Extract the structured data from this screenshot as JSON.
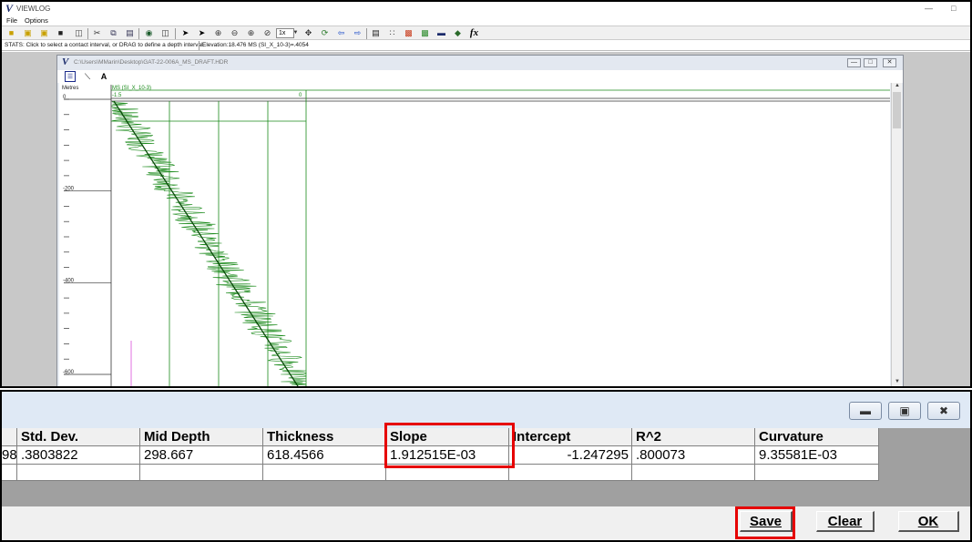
{
  "app": {
    "title": "VIEWLOG",
    "menus": [
      "File",
      "Options"
    ],
    "zoom": "1x",
    "status": "STATS: Click to select a contact interval, or DRAG to define a depth interval.",
    "elevation": "Elevation:18.476 MS (SI_X_10-3)=.4054"
  },
  "document": {
    "path": "C:\\Users\\MMarin\\Desktop\\GAT-22-006A_MS_DRAFT.HDR",
    "depth_unit": "Metres",
    "depth_ticks": [
      "0",
      "-200",
      "-400",
      "-600"
    ],
    "track_title": "MS (SI_X_10-3)",
    "track_min": "-1.5",
    "track_max": "0"
  },
  "stats": {
    "columns": [
      {
        "header": "",
        "value": "98"
      },
      {
        "header": "Std. Dev.",
        "value": ".3803822"
      },
      {
        "header": "Mid Depth",
        "value": "298.667"
      },
      {
        "header": "Thickness",
        "value": "618.4566"
      },
      {
        "header": "Slope",
        "value": "1.912515E-03"
      },
      {
        "header": "Intercept",
        "value": "-1.247295"
      },
      {
        "header": "R^2",
        "value": ".800073"
      },
      {
        "header": "Curvature",
        "value": "9.35581E-03"
      }
    ],
    "buttons": {
      "save": "Save",
      "clear": "Clear",
      "ok": "OK"
    }
  },
  "colors": {
    "highlight": "#e60000",
    "log_curve": "#1a8a1a",
    "fit_line": "#0a4a0a"
  }
}
